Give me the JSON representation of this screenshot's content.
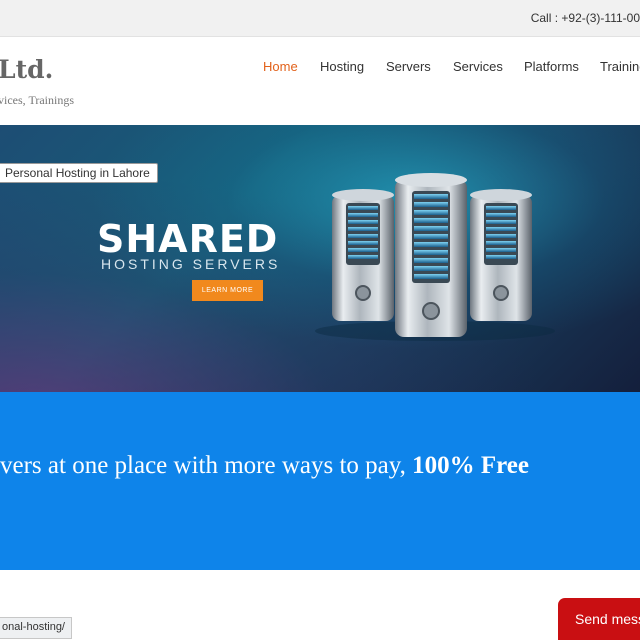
{
  "topbar": {
    "call": "Call : +92-(3)-111-00"
  },
  "header": {
    "logo": "Ltd.",
    "tagline": "vices, Trainings"
  },
  "nav": {
    "items": [
      "Home",
      "Hosting",
      "Servers",
      "Services",
      "Platforms",
      "Training"
    ],
    "active": "Home"
  },
  "banner": {
    "badge": "Personal Hosting in Lahore",
    "title": "SHARED",
    "subtitle": "HOSTING  SERVERS",
    "cta": "LEARN MORE"
  },
  "promo": {
    "text": "vers at one place with more ways to pay, ",
    "bold": "100% Free"
  },
  "status": {
    "url": "onal-hosting/"
  },
  "chat": {
    "label": "Send mess"
  },
  "colors": {
    "accent": "#e2621b",
    "cta": "#f1891d",
    "promo_bg": "#0e84ea",
    "chat_bg": "#c90f12"
  },
  "icons": [
    "server-illustration"
  ]
}
